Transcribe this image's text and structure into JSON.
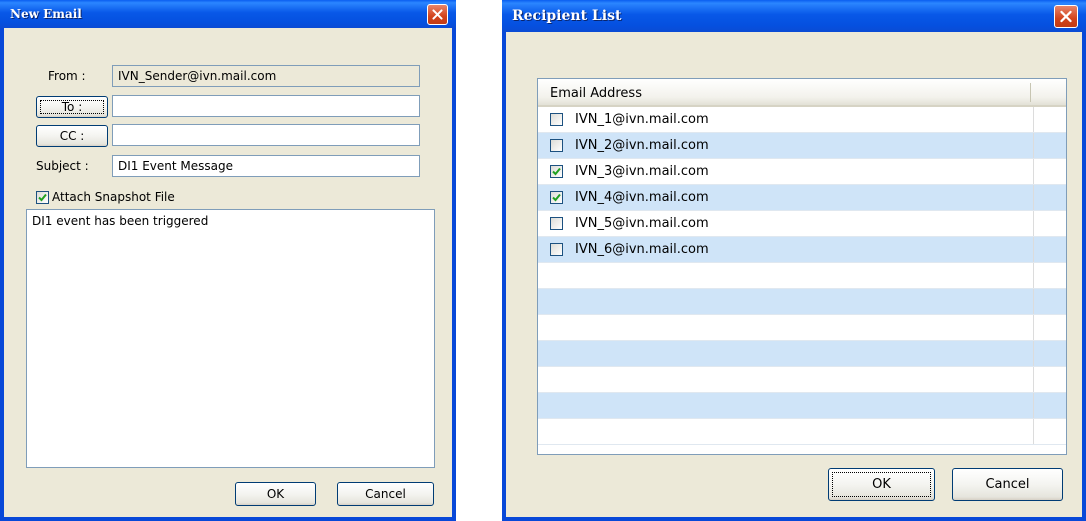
{
  "email_window": {
    "title": "New Email",
    "from_label": "From :",
    "from_value": "IVN_Sender@ivn.mail.com",
    "to_button": "To :",
    "to_value": "",
    "cc_button": "CC :",
    "cc_value": "",
    "subject_label": "Subject :",
    "subject_value": "DI1 Event Message",
    "attach_label": "Attach Snapshot File",
    "attach_checked": true,
    "body": "DI1 event has been triggered",
    "ok_label": "OK",
    "cancel_label": "Cancel"
  },
  "recipient_window": {
    "title": "Recipient List",
    "column_header": "Email Address",
    "recipients": [
      {
        "email": "IVN_1@ivn.mail.com",
        "checked": false
      },
      {
        "email": "IVN_2@ivn.mail.com",
        "checked": false
      },
      {
        "email": "IVN_3@ivn.mail.com",
        "checked": true
      },
      {
        "email": "IVN_4@ivn.mail.com",
        "checked": true
      },
      {
        "email": "IVN_5@ivn.mail.com",
        "checked": false
      },
      {
        "email": "IVN_6@ivn.mail.com",
        "checked": false
      }
    ],
    "ok_label": "OK",
    "cancel_label": "Cancel"
  },
  "colors": {
    "titlebar": "#0858e8",
    "window_bg": "#ece9d8",
    "row_alt": "#cfe4f8",
    "checkmark": "#21a121",
    "close_button": "#d2431c"
  }
}
